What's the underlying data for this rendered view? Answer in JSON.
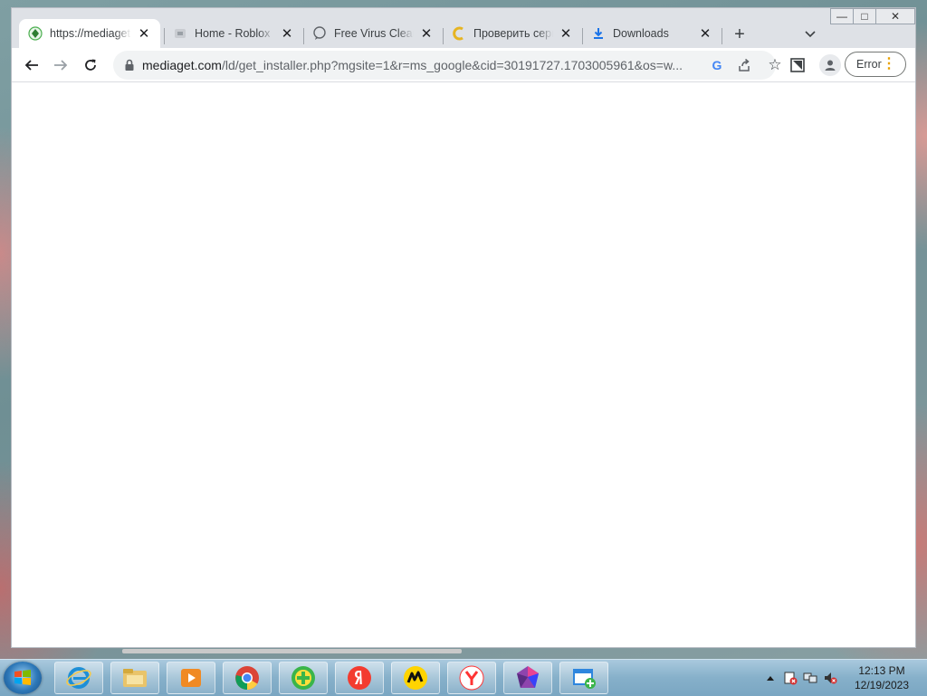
{
  "window": {
    "controls": {
      "minimize": "—",
      "maximize": "□",
      "close": "✕"
    }
  },
  "tabs": [
    {
      "title": "https://mediaget.com/ld/get_installer.php",
      "icon": "mediaget-icon",
      "active": true
    },
    {
      "title": "Home - Roblox",
      "icon": "roblox-icon",
      "active": false
    },
    {
      "title": "Free Virus Cleaner",
      "icon": "comment-icon",
      "active": false
    },
    {
      "title": "Проверить сервис",
      "icon": "yellow-c-icon",
      "active": false
    },
    {
      "title": "Downloads",
      "icon": "download-icon",
      "active": false
    }
  ],
  "tab_close_glyph": "✕",
  "newtab_glyph": "+",
  "tabsearch_glyph": "⌄",
  "toolbar": {
    "back": "←",
    "forward": "→",
    "reload": "↻",
    "url_host": "mediaget.com",
    "url_path": "/ld/get_installer.php?mgsite=1&r=ms_google&cid=30191727.1703005961&os=w...",
    "google_glyph": "G",
    "share_glyph": "⇪",
    "star_glyph": "☆",
    "error_label": "Error",
    "menu_glyph": "⋮"
  },
  "taskbar": {
    "apps": [
      {
        "name": "internet-explorer-icon",
        "color": "#1e8fd6"
      },
      {
        "name": "file-explorer-icon",
        "color": "#e9c46a"
      },
      {
        "name": "media-player-icon",
        "color": "#f08a24"
      },
      {
        "name": "chrome-icon",
        "color": "#db4437"
      },
      {
        "name": "mediaget-app-icon",
        "color": "#3ab54a"
      },
      {
        "name": "yandex-icon",
        "color": "#f33b2f"
      },
      {
        "name": "yandex-market-icon",
        "color": "#ffd400"
      },
      {
        "name": "yandex-browser-icon",
        "color": "#ff3333"
      },
      {
        "name": "crystal-icon",
        "color": "#8e44ad"
      },
      {
        "name": "scheduler-icon",
        "color": "#2e86de"
      }
    ],
    "time": "12:13 PM",
    "date": "12/19/2023"
  }
}
